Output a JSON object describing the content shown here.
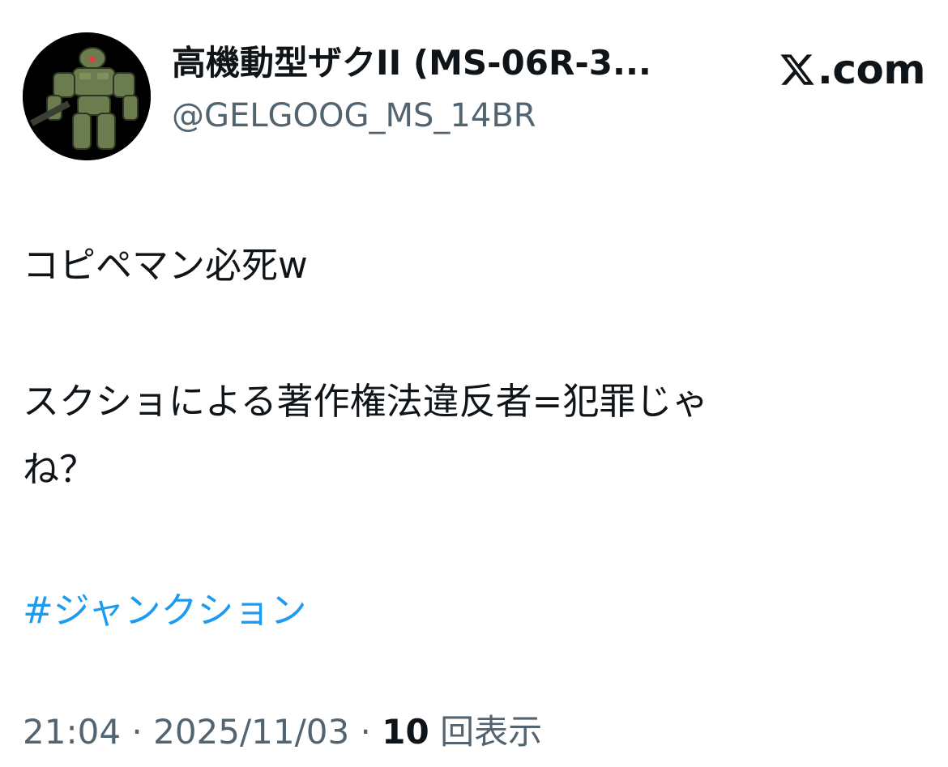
{
  "author": {
    "display_name": "高機動型ザクII (MS-06R-3...",
    "handle": "@GELGOOG_MS_14BR",
    "avatar_icon": "robot-avatar-icon"
  },
  "brand": {
    "logo_icon": "x-logo-icon",
    "text": ".com"
  },
  "tweet": {
    "line1": "コピペマン必死w",
    "line2": "スクショによる著作権法違反者=犯罪じゃ",
    "line3": "ね？",
    "hashtag": "#ジャンクション"
  },
  "meta": {
    "time": "21:04",
    "separator": " · ",
    "date": "2025/11/03",
    "views_count": "10",
    "views_label": "回表示"
  },
  "colors": {
    "text": "#0f1419",
    "secondary": "#536471",
    "link": "#1d9bf0",
    "background": "#ffffff"
  }
}
